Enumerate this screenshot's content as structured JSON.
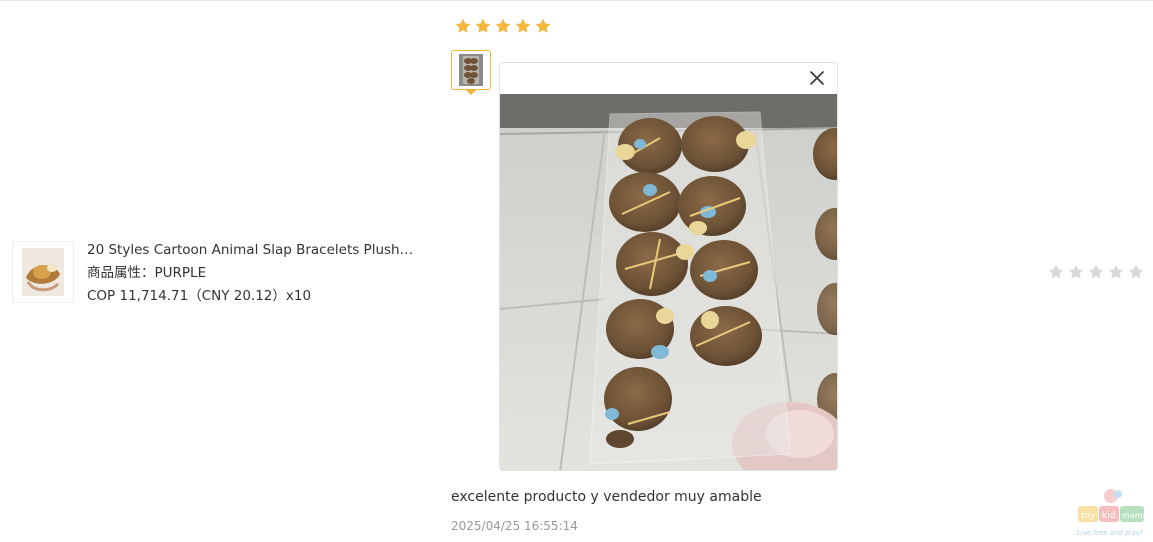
{
  "review": {
    "rating": 5,
    "rating_max": 5,
    "text": "excelente producto y vendedor muy amable",
    "date": "2025/04/25 16:55:14",
    "photo_count": 1
  },
  "product": {
    "title": "20 Styles Cartoon Animal Slap Bracelets Plush C...",
    "attribute": "商品属性：PURPLE",
    "price_line": "COP 11,714.71（CNY  20.12）x10"
  },
  "right_rating": {
    "rating": 0,
    "rating_max": 5
  },
  "colors": {
    "star_filled": "#f5b73b",
    "star_empty": "#d9d9d9",
    "thumb_border": "#f0b33a"
  },
  "icons": {
    "close": "close-icon",
    "star": "star-icon"
  },
  "watermark": {
    "brand": "toykidmama",
    "tagline": "Live free and play!"
  }
}
